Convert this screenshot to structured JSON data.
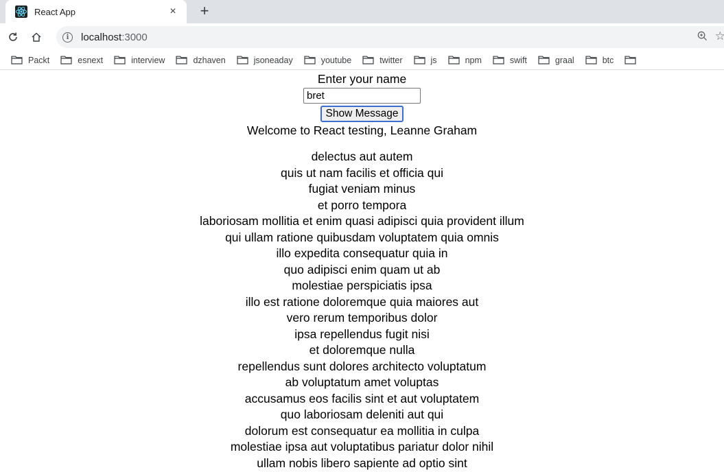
{
  "browser": {
    "tab": {
      "title": "React App",
      "close": "×"
    },
    "new_tab": "+",
    "url": {
      "host": "localhost",
      "port": ":3000"
    },
    "bookmarks": [
      "Packt",
      "esnext",
      "interview",
      "dzhaven",
      "jsoneaday",
      "youtube",
      "twitter",
      "js",
      "npm",
      "swift",
      "graal",
      "btc",
      ""
    ]
  },
  "form": {
    "label": "Enter your name",
    "input_value": "bret",
    "button_label": "Show Message"
  },
  "welcome": "Welcome to React testing, Leanne Graham",
  "todos": [
    "delectus aut autem",
    "quis ut nam facilis et officia qui",
    "fugiat veniam minus",
    "et porro tempora",
    "laboriosam mollitia et enim quasi adipisci quia provident illum",
    "qui ullam ratione quibusdam voluptatem quia omnis",
    "illo expedita consequatur quia in",
    "quo adipisci enim quam ut ab",
    "molestiae perspiciatis ipsa",
    "illo est ratione doloremque quia maiores aut",
    "vero rerum temporibus dolor",
    "ipsa repellendus fugit nisi",
    "et doloremque nulla",
    "repellendus sunt dolores architecto voluptatum",
    "ab voluptatum amet voluptas",
    "accusamus eos facilis sint et aut voluptatem",
    "quo laboriosam deleniti aut qui",
    "dolorum est consequatur ea mollitia in culpa",
    "molestiae ipsa aut voluptatibus pariatur dolor nihil",
    "ullam nobis libero sapiente ad optio sint"
  ],
  "colors": {
    "button_border": "#3b6ecf",
    "react_logo": "#61dafb"
  }
}
